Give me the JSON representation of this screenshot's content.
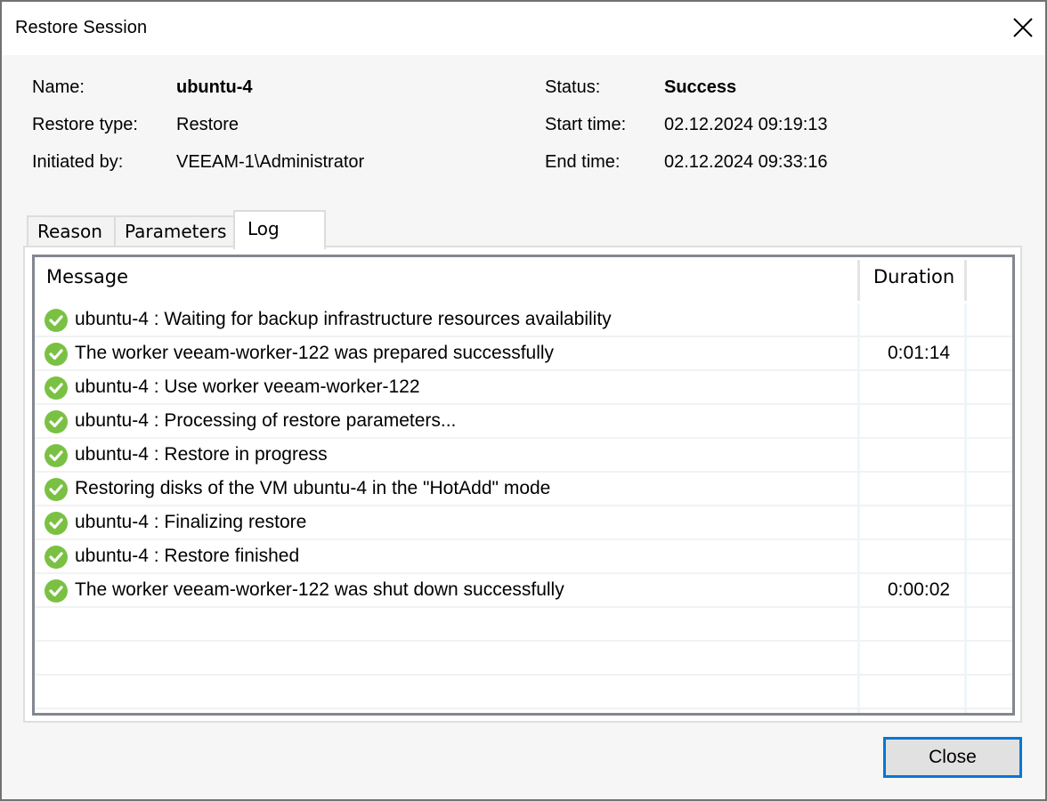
{
  "window": {
    "title": "Restore Session",
    "close_icon": "close-x-icon"
  },
  "info": {
    "name_label": "Name:",
    "name_value": "ubuntu-4",
    "restore_type_label": "Restore type:",
    "restore_type_value": "Restore",
    "initiated_by_label": "Initiated by:",
    "initiated_by_value": "VEEAM-1\\Administrator",
    "status_label": "Status:",
    "status_value": "Success",
    "start_time_label": "Start time:",
    "start_time_value": "02.12.2024 09:19:13",
    "end_time_label": "End time:",
    "end_time_value": "02.12.2024 09:33:16"
  },
  "tabs": [
    {
      "label": "Reason",
      "active": false
    },
    {
      "label": "Parameters",
      "active": false
    },
    {
      "label": "Log",
      "active": true
    }
  ],
  "log": {
    "columns": {
      "message": "Message",
      "duration": "Duration"
    },
    "status_icon": "success-check-icon",
    "status_color": "#7ac143",
    "rows": [
      {
        "message": "ubuntu-4 : Waiting for backup infrastructure resources availability",
        "duration": ""
      },
      {
        "message": "The worker veeam-worker-122 was prepared successfully",
        "duration": "0:01:14"
      },
      {
        "message": "ubuntu-4 : Use worker veeam-worker-122",
        "duration": ""
      },
      {
        "message": "ubuntu-4 : Processing of restore parameters...",
        "duration": ""
      },
      {
        "message": "ubuntu-4 : Restore in progress",
        "duration": ""
      },
      {
        "message": "Restoring disks of the VM ubuntu-4 in the \"HotAdd\" mode",
        "duration": ""
      },
      {
        "message": "ubuntu-4 : Finalizing restore",
        "duration": ""
      },
      {
        "message": "ubuntu-4 : Restore finished",
        "duration": ""
      },
      {
        "message": "The worker veeam-worker-122 was shut down successfully",
        "duration": "0:00:02"
      }
    ]
  },
  "footer": {
    "close_label": "Close"
  }
}
